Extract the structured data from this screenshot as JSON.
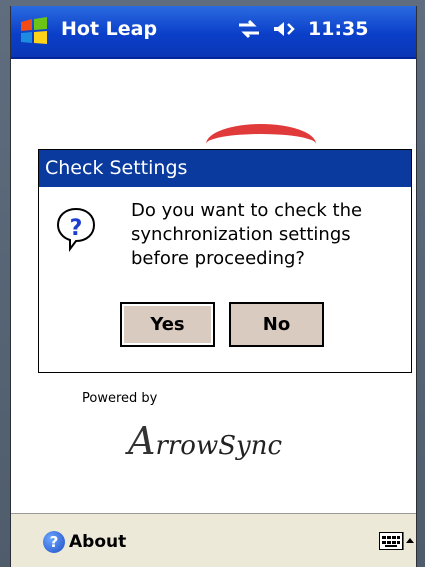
{
  "titlebar": {
    "app_title": "Hot Leap",
    "time": "11:35",
    "icons": [
      "windows-start-icon",
      "connectivity-icon",
      "speaker-icon"
    ]
  },
  "dialog": {
    "title": "Check Settings",
    "message": "Do you want to check the synchronization settings before proceeding?",
    "yes_label": "Yes",
    "no_label": "No",
    "icon": "question-icon"
  },
  "branding": {
    "powered_by": "Powered by",
    "logo_text": "ArrowSync",
    "logo_initial": "A",
    "logo_rest": "rrowSync"
  },
  "bottombar": {
    "about_label": "About",
    "icons": [
      "help-icon",
      "keyboard-icon",
      "sip-arrow-icon"
    ]
  },
  "colors": {
    "titlebar": "#0b3fc9",
    "dialog_title": "#0a3a9e",
    "button": "#d9cbc0",
    "accent_red": "#e03030"
  }
}
